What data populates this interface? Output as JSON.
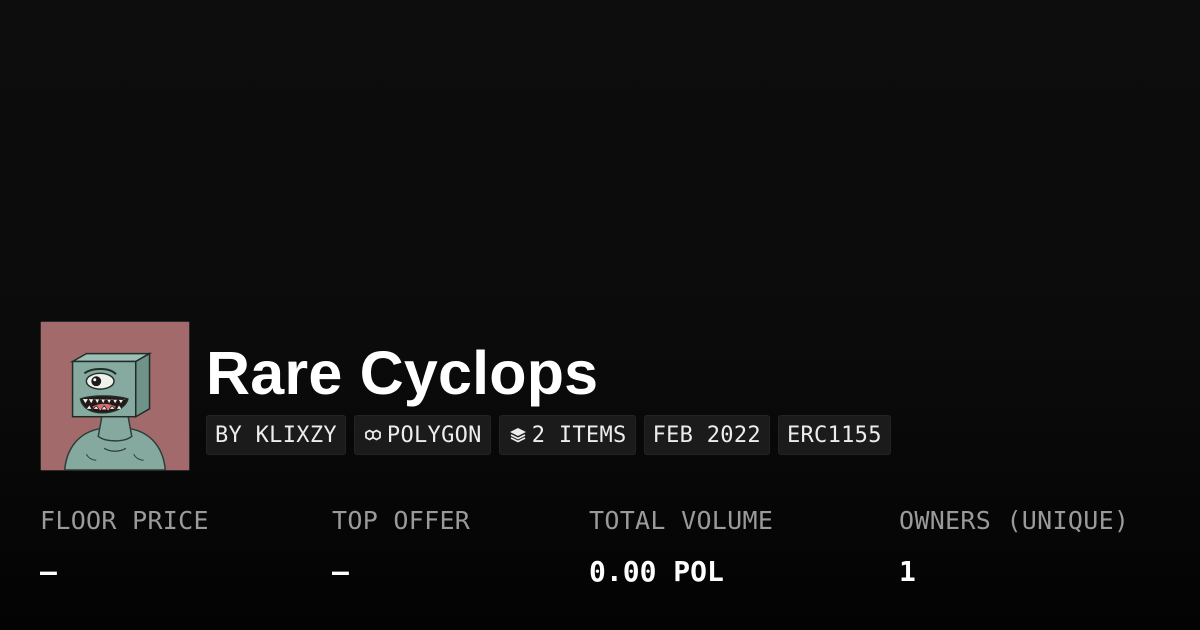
{
  "collection": {
    "name": "Rare Cyclops",
    "avatar_alt": "Rare Cyclops collection image"
  },
  "tags": {
    "creator": "BY KLIXZY",
    "chain": "POLYGON",
    "items": "2 ITEMS",
    "date": "FEB 2022",
    "standard": "ERC1155"
  },
  "icons": {
    "chain": "polygon-icon",
    "items": "layers-icon"
  },
  "stats": {
    "floor_price": {
      "label": "FLOOR PRICE",
      "value": "–"
    },
    "top_offer": {
      "label": "TOP OFFER",
      "value": "–"
    },
    "total_volume": {
      "label": "TOTAL VOLUME",
      "value": "0.00 POL"
    },
    "owners": {
      "label": "OWNERS (UNIQUE)",
      "value": "1"
    }
  },
  "colors": {
    "background": "#0c0c0c",
    "avatar_bg": "#a26a6b",
    "tag_bg": "#1b1b1b",
    "label": "#9a9a9a",
    "value": "#ffffff"
  }
}
